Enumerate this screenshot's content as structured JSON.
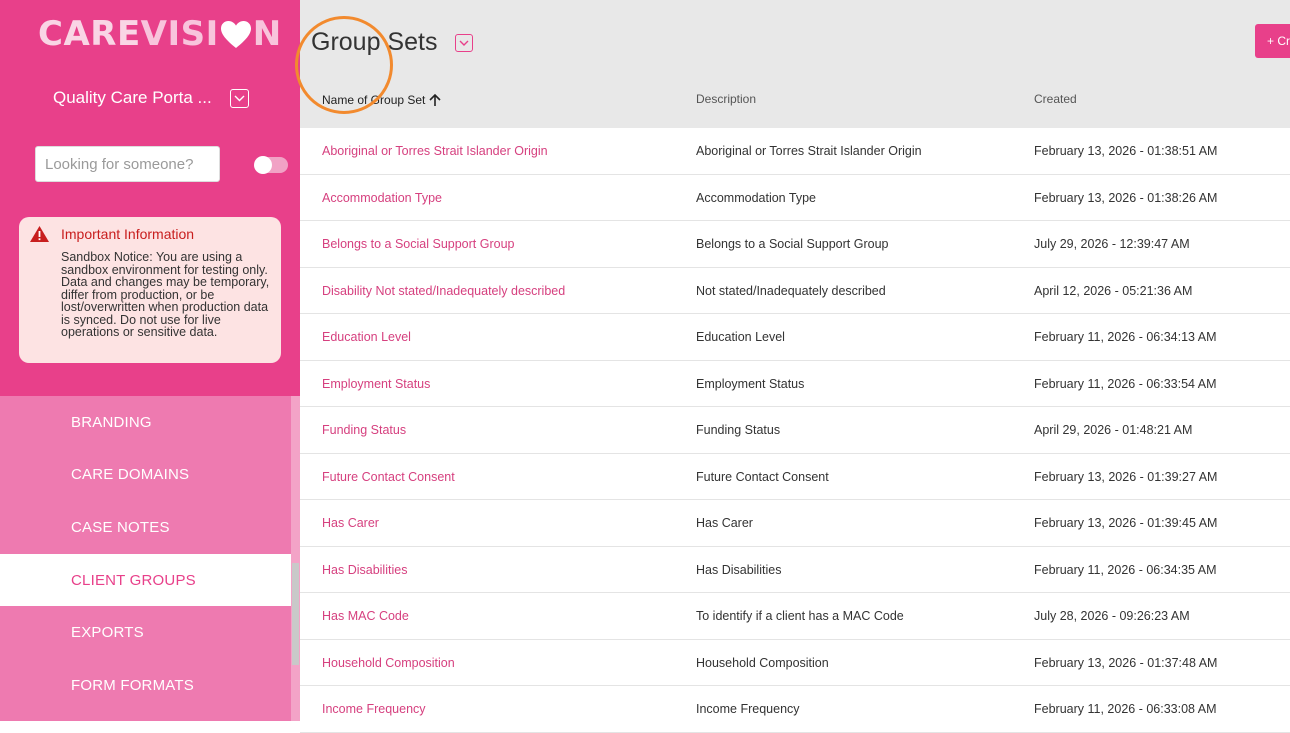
{
  "sidebar": {
    "logo_part1": "CARE",
    "logo_part2": "VISI",
    "logo_part3": "N",
    "portal_name": "Quality Care Porta ...",
    "search_placeholder": "Looking for someone?",
    "info_title": "Important Information",
    "info_text": "Sandbox Notice: You are using a sandbox environment for testing only. Data and changes may be temporary, differ from production, or be lost/overwritten when production data is synced. Do not use for live operations or sensitive data.",
    "nav_items": [
      {
        "label": "BRANDING"
      },
      {
        "label": "CARE DOMAINS"
      },
      {
        "label": "CASE NOTES"
      },
      {
        "label": "CLIENT GROUPS",
        "active": true
      },
      {
        "label": "EXPORTS"
      },
      {
        "label": "FORM FORMATS"
      }
    ]
  },
  "header": {
    "title": "Group Sets",
    "create_label": "+ Cr"
  },
  "table": {
    "columns": [
      "Name of Group Set",
      "Description",
      "Created"
    ],
    "sort_column": "Name of Group Set",
    "sort_direction": "ascending",
    "rows": [
      {
        "name": "Aboriginal or Torres Strait Islander Origin",
        "description": "Aboriginal or Torres Strait Islander Origin",
        "created": "February 13, 2026 - 01:38:51 AM"
      },
      {
        "name": "Accommodation Type",
        "description": "Accommodation Type",
        "created": "February 13, 2026 - 01:38:26 AM"
      },
      {
        "name": "Belongs to a Social Support Group",
        "description": "Belongs to a Social Support Group",
        "created": "July 29, 2026 - 12:39:47 AM"
      },
      {
        "name": "Disability Not stated/Inadequately described",
        "description": "Not stated/Inadequately described",
        "created": "April 12, 2026 - 05:21:36 AM"
      },
      {
        "name": "Education Level",
        "description": "Education Level",
        "created": "February 11, 2026 - 06:34:13 AM"
      },
      {
        "name": "Employment Status",
        "description": "Employment Status",
        "created": "February 11, 2026 - 06:33:54 AM"
      },
      {
        "name": "Funding Status",
        "description": "Funding Status",
        "created": "April 29, 2026 - 01:48:21 AM"
      },
      {
        "name": "Future Contact Consent",
        "description": "Future Contact Consent",
        "created": "February 13, 2026 - 01:39:27 AM"
      },
      {
        "name": "Has Carer",
        "description": "Has Carer",
        "created": "February 13, 2026 - 01:39:45 AM"
      },
      {
        "name": "Has Disabilities",
        "description": "Has Disabilities",
        "created": "February 11, 2026 - 06:34:35 AM"
      },
      {
        "name": "Has MAC Code",
        "description": "To identify if a client has a MAC Code",
        "created": "July 28, 2026 - 09:26:23 AM"
      },
      {
        "name": "Household Composition",
        "description": "Household Composition",
        "created": "February 13, 2026 - 01:37:48 AM"
      },
      {
        "name": "Income Frequency",
        "description": "Income Frequency",
        "created": "February 11, 2026 - 06:33:08 AM"
      }
    ]
  },
  "colors": {
    "brand_pink": "#e8408a",
    "nav_pink": "#ee7ab0",
    "link_pink": "#d6407f",
    "header_gray": "#e8e8e8",
    "warning_red": "#c81e1e",
    "highlight_orange": "#f28a2e"
  },
  "icons": {
    "logo_heart": "heart-icon",
    "portal_dropdown": "chevron-down-icon",
    "title_dropdown": "chevron-down-icon",
    "warning": "warning-icon",
    "sort": "arrow-up-icon"
  }
}
